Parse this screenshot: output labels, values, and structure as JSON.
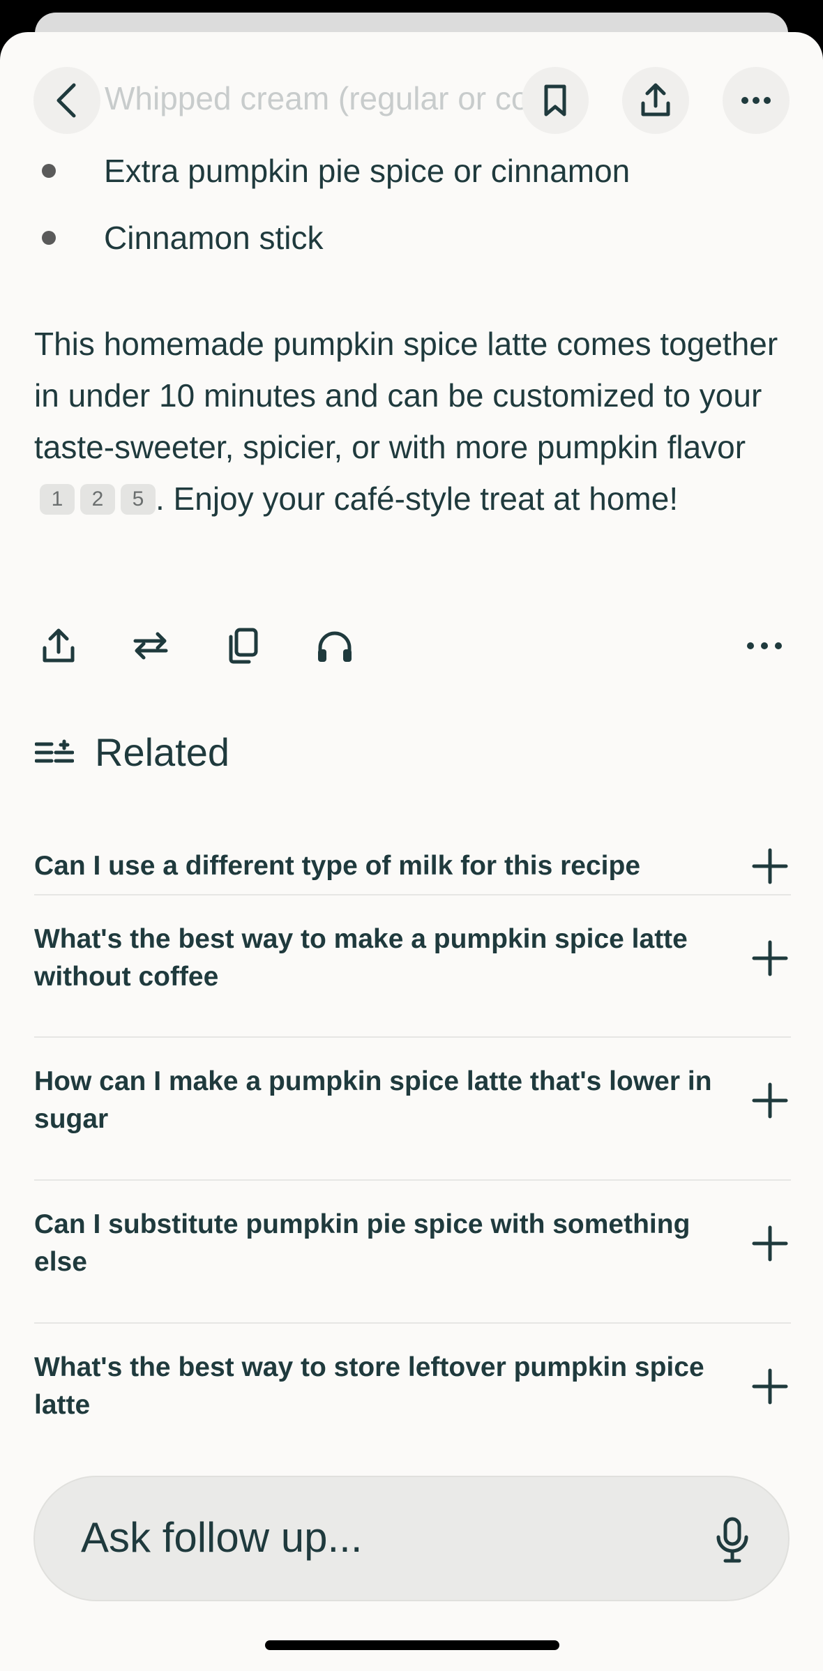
{
  "top_bar": {
    "faded_text": "Whipped cream (regular or coconut)",
    "back_icon": "chevron-left-icon",
    "bookmark_icon": "bookmark-icon",
    "share_icon": "share-icon",
    "more_icon": "more-horizontal-icon"
  },
  "bullets": [
    "Extra pumpkin pie spice or cinnamon",
    "Cinnamon stick"
  ],
  "answer": {
    "text_before": "This homemade pumpkin spice latte comes together in under 10 minutes and can be customized to your taste-sweeter, spicier, or with more pumpkin flavor",
    "citations": [
      "1",
      "2",
      "5"
    ],
    "text_after": ". Enjoy your café-style treat at home!"
  },
  "actions": {
    "share": "share-icon",
    "rewrite": "rewrite-icon",
    "copy": "copy-icon",
    "listen": "headphones-icon",
    "more": "more-horizontal-icon"
  },
  "related": {
    "title": "Related",
    "icon": "related-list-icon",
    "items": [
      "Can I use a different type of milk for this recipe",
      "What's the best way to make a pumpkin spice latte without coffee",
      "How can I make a pumpkin spice latte that's lower in sugar",
      "Can I substitute pumpkin pie spice with something else",
      "What's the best way to store leftover pumpkin spice latte"
    ]
  },
  "ask": {
    "placeholder": "Ask follow up...",
    "mic_icon": "microphone-icon"
  }
}
